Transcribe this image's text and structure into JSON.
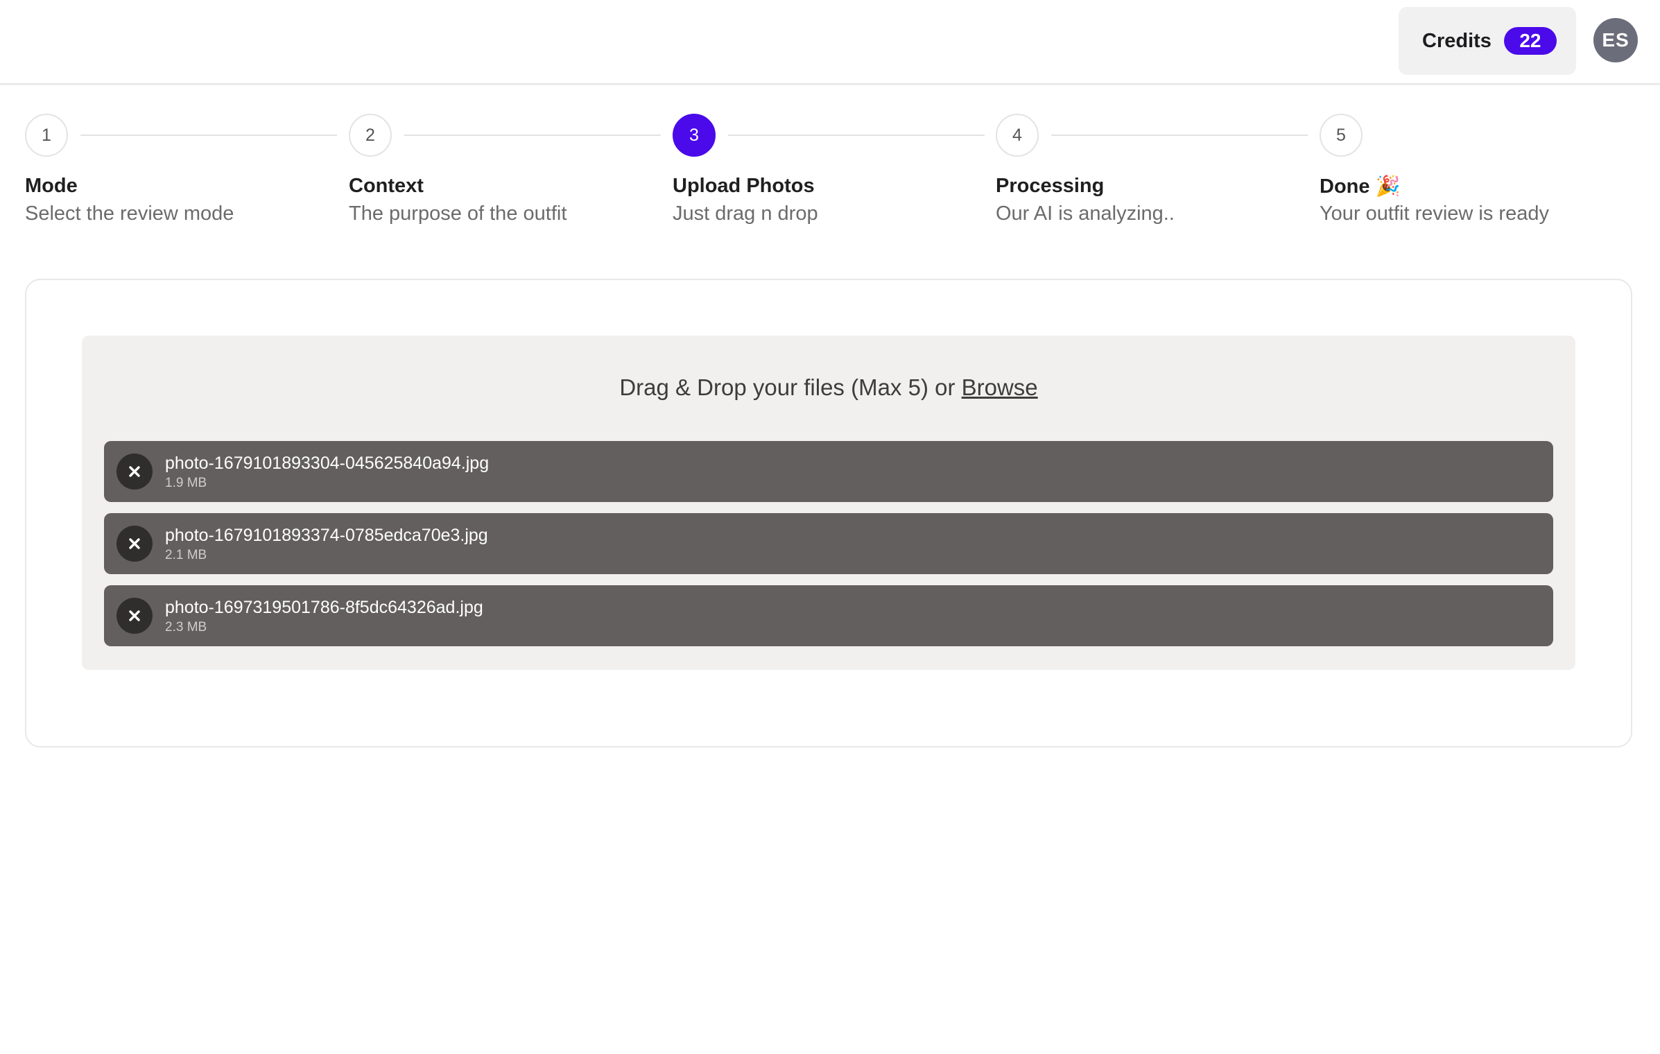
{
  "header": {
    "credits_label": "Credits",
    "credits_count": "22",
    "avatar_initials": "ES"
  },
  "stepper": {
    "steps": [
      {
        "number": "1",
        "title": "Mode",
        "subtitle": "Select the review mode",
        "state": "default"
      },
      {
        "number": "2",
        "title": "Context",
        "subtitle": "The purpose of the outfit",
        "state": "default"
      },
      {
        "number": "3",
        "title": "Upload Photos",
        "subtitle": "Just drag n drop",
        "state": "active"
      },
      {
        "number": "4",
        "title": "Processing",
        "subtitle": "Our AI is analyzing..",
        "state": "default"
      },
      {
        "number": "5",
        "title": "Done 🎉",
        "subtitle": "Your outfit review is ready",
        "state": "default"
      }
    ]
  },
  "upload": {
    "prompt": "Drag & Drop your files (Max 5) or",
    "browse_label": "Browse",
    "files": [
      {
        "name": "photo-1679101893304-045625840a94.jpg",
        "size": "1.9 MB"
      },
      {
        "name": "photo-1679101893374-0785edca70e3.jpg",
        "size": "2.1 MB"
      },
      {
        "name": "photo-1697319501786-8f5dc64326ad.jpg",
        "size": "2.3 MB"
      }
    ]
  },
  "colors": {
    "accent": "#4b0aea",
    "file_row_bg": "#625f5e",
    "dropzone_bg": "#f1f0ef"
  }
}
